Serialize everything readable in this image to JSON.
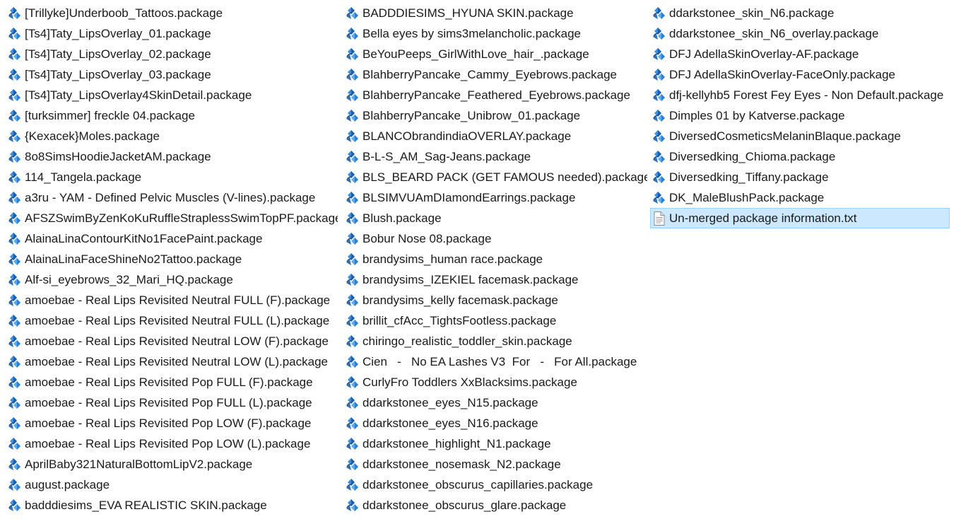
{
  "accent_color": "#2f7fd1",
  "selection_color": "#cce8ff",
  "columns": [
    {
      "files": [
        {
          "name": "[Trillyke]Underboob_Tattoos.package",
          "icon": "sims-package-icon"
        },
        {
          "name": "[Ts4]Taty_LipsOverlay_01.package",
          "icon": "sims-package-icon"
        },
        {
          "name": "[Ts4]Taty_LipsOverlay_02.package",
          "icon": "sims-package-icon"
        },
        {
          "name": "[Ts4]Taty_LipsOverlay_03.package",
          "icon": "sims-package-icon"
        },
        {
          "name": "[Ts4]Taty_LipsOverlay4SkinDetail.package",
          "icon": "sims-package-icon"
        },
        {
          "name": "[turksimmer] freckle 04.package",
          "icon": "sims-package-icon"
        },
        {
          "name": "{Kexacek}Moles.package",
          "icon": "sims-package-icon"
        },
        {
          "name": "8o8SimsHoodieJacketAM.package",
          "icon": "sims-package-icon"
        },
        {
          "name": "114_Tangela.package",
          "icon": "sims-package-icon"
        },
        {
          "name": "a3ru - YAM - Defined Pelvic Muscles (V-lines).package",
          "icon": "sims-package-icon"
        },
        {
          "name": "AFSZSwimByZenKoKuRuffleStraplessSwimTopPF.package",
          "icon": "sims-package-icon"
        },
        {
          "name": "AlainaLinaContourKitNo1FacePaint.package",
          "icon": "sims-package-icon"
        },
        {
          "name": "AlainaLinaFaceShineNo2Tattoo.package",
          "icon": "sims-package-icon"
        },
        {
          "name": "Alf-si_eyebrows_32_Mari_HQ.package",
          "icon": "sims-package-icon"
        },
        {
          "name": "amoebae - Real Lips Revisited Neutral FULL (F).package",
          "icon": "sims-package-icon"
        },
        {
          "name": "amoebae - Real Lips Revisited Neutral FULL (L).package",
          "icon": "sims-package-icon"
        },
        {
          "name": "amoebae - Real Lips Revisited Neutral LOW (F).package",
          "icon": "sims-package-icon"
        },
        {
          "name": "amoebae - Real Lips Revisited Neutral LOW (L).package",
          "icon": "sims-package-icon"
        },
        {
          "name": "amoebae - Real Lips Revisited Pop FULL (F).package",
          "icon": "sims-package-icon"
        },
        {
          "name": "amoebae - Real Lips Revisited Pop FULL (L).package",
          "icon": "sims-package-icon"
        },
        {
          "name": "amoebae - Real Lips Revisited Pop LOW (F).package",
          "icon": "sims-package-icon"
        },
        {
          "name": "amoebae - Real Lips Revisited Pop LOW (L).package",
          "icon": "sims-package-icon"
        },
        {
          "name": "AprilBaby321NaturalBottomLipV2.package",
          "icon": "sims-package-icon"
        },
        {
          "name": "august.package",
          "icon": "sims-package-icon"
        },
        {
          "name": "badddiesims_EVA REALISTIC SKIN.package",
          "icon": "sims-package-icon"
        }
      ]
    },
    {
      "files": [
        {
          "name": "BADDDIESIMS_HYUNA SKIN.package",
          "icon": "sims-package-icon"
        },
        {
          "name": "Bella eyes by sims3melancholic.package",
          "icon": "sims-package-icon"
        },
        {
          "name": "BeYouPeeps_GirlWithLove_hair_.package",
          "icon": "sims-package-icon"
        },
        {
          "name": "BlahberryPancake_Cammy_Eyebrows.package",
          "icon": "sims-package-icon"
        },
        {
          "name": "BlahberryPancake_Feathered_Eyebrows.package",
          "icon": "sims-package-icon"
        },
        {
          "name": "BlahberryPancake_Unibrow_01.package",
          "icon": "sims-package-icon"
        },
        {
          "name": "BLANCObrandindiaOVERLAY.package",
          "icon": "sims-package-icon"
        },
        {
          "name": "B-L-S_AM_Sag-Jeans.package",
          "icon": "sims-package-icon"
        },
        {
          "name": "BLS_BEARD PACK (GET FAMOUS needed).package",
          "icon": "sims-package-icon"
        },
        {
          "name": "BLSIMVUAmDIamondEarrings.package",
          "icon": "sims-package-icon"
        },
        {
          "name": "Blush.package",
          "icon": "sims-package-icon"
        },
        {
          "name": "Bobur Nose 08.package",
          "icon": "sims-package-icon"
        },
        {
          "name": "brandysims_human race.package",
          "icon": "sims-package-icon"
        },
        {
          "name": "brandysims_IZEKIEL facemask.package",
          "icon": "sims-package-icon"
        },
        {
          "name": "brandysims_kelly facemask.package",
          "icon": "sims-package-icon"
        },
        {
          "name": "brillit_cfAcc_TightsFootless.package",
          "icon": "sims-package-icon"
        },
        {
          "name": "chiringo_realistic_toddler_skin.package",
          "icon": "sims-package-icon"
        },
        {
          "name": "Cien   -   No EA Lashes V3  For   -   For All.package",
          "icon": "sims-package-icon"
        },
        {
          "name": "CurlyFro Toddlers XxBlacksims.package",
          "icon": "sims-package-icon"
        },
        {
          "name": "ddarkstonee_eyes_N15.package",
          "icon": "sims-package-icon"
        },
        {
          "name": "ddarkstonee_eyes_N16.package",
          "icon": "sims-package-icon"
        },
        {
          "name": "ddarkstonee_highlight_N1.package",
          "icon": "sims-package-icon"
        },
        {
          "name": "ddarkstonee_nosemask_N2.package",
          "icon": "sims-package-icon"
        },
        {
          "name": "ddarkstonee_obscurus_capillaries.package",
          "icon": "sims-package-icon"
        },
        {
          "name": "ddarkstonee_obscurus_glare.package",
          "icon": "sims-package-icon"
        }
      ]
    },
    {
      "files": [
        {
          "name": "ddarkstonee_skin_N6.package",
          "icon": "sims-package-icon"
        },
        {
          "name": "ddarkstonee_skin_N6_overlay.package",
          "icon": "sims-package-icon"
        },
        {
          "name": "DFJ AdellaSkinOverlay-AF.package",
          "icon": "sims-package-icon"
        },
        {
          "name": "DFJ AdellaSkinOverlay-FaceOnly.package",
          "icon": "sims-package-icon"
        },
        {
          "name": "dfj-kellyhb5 Forest Fey Eyes - Non Default.package",
          "icon": "sims-package-icon"
        },
        {
          "name": "Dimples 01 by Katverse.package",
          "icon": "sims-package-icon"
        },
        {
          "name": "DiversedCosmeticsMelaninBlaque.package",
          "icon": "sims-package-icon"
        },
        {
          "name": "Diversedking_Chioma.package",
          "icon": "sims-package-icon"
        },
        {
          "name": "Diversedking_Tiffany.package",
          "icon": "sims-package-icon"
        },
        {
          "name": "DK_MaleBlushPack.package",
          "icon": "sims-package-icon"
        },
        {
          "name": "Un-merged package information.txt",
          "icon": "text-document-icon",
          "selected": true
        }
      ]
    }
  ]
}
